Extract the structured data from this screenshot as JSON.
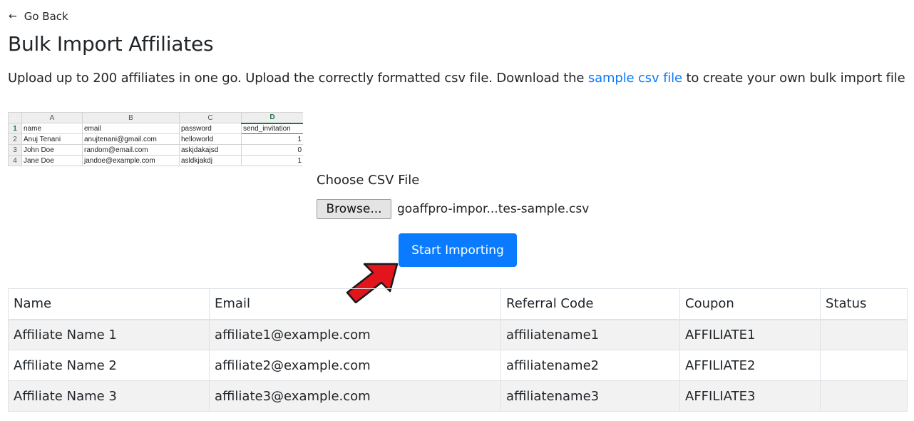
{
  "nav": {
    "back_arrow": "←",
    "back_label": "Go Back"
  },
  "page": {
    "title": "Bulk Import Affiliates",
    "desc_before": "Upload up to 200 affiliates in one go. Upload the correctly formatted csv file. Download the",
    "desc_link": "sample csv file",
    "desc_after": "to create your own bulk import file"
  },
  "sample_sheet": {
    "columns": [
      "A",
      "B",
      "C",
      "D"
    ],
    "rows": [
      {
        "n": "1",
        "cells": [
          "name",
          "email",
          "password",
          "send_invitation"
        ]
      },
      {
        "n": "2",
        "cells": [
          "Anuj Tenani",
          "anujtenani@gmail.com",
          "helloworld",
          "1"
        ]
      },
      {
        "n": "3",
        "cells": [
          "John Doe",
          "random@email.com",
          "askjdakajsd",
          "0"
        ]
      },
      {
        "n": "4",
        "cells": [
          "Jane Doe",
          "jandoe@example.com",
          "asldkjakdj",
          "1"
        ]
      }
    ]
  },
  "upload": {
    "label": "Choose CSV File",
    "browse_label": "Browse...",
    "file_name": "goaffpro-impor...tes-sample.csv",
    "start_label": "Start Importing"
  },
  "table": {
    "headers": [
      "Name",
      "Email",
      "Referral Code",
      "Coupon",
      "Status"
    ],
    "rows": [
      [
        "Affiliate Name 1",
        "affiliate1@example.com",
        "affiliatename1",
        "AFFILIATE1",
        ""
      ],
      [
        "Affiliate Name 2",
        "affiliate2@example.com",
        "affiliatename2",
        "AFFILIATE2",
        ""
      ],
      [
        "Affiliate Name 3",
        "affiliate3@example.com",
        "affiliatename3",
        "AFFILIATE3",
        ""
      ]
    ]
  },
  "colors": {
    "primary": "#0a7bff",
    "link": "#0a7bff",
    "annotation_arrow": "#e2141c",
    "sheet_accent": "#217346"
  },
  "icons": {
    "back": "arrow-left-icon",
    "pointer": "red-pointer-arrow-icon"
  }
}
